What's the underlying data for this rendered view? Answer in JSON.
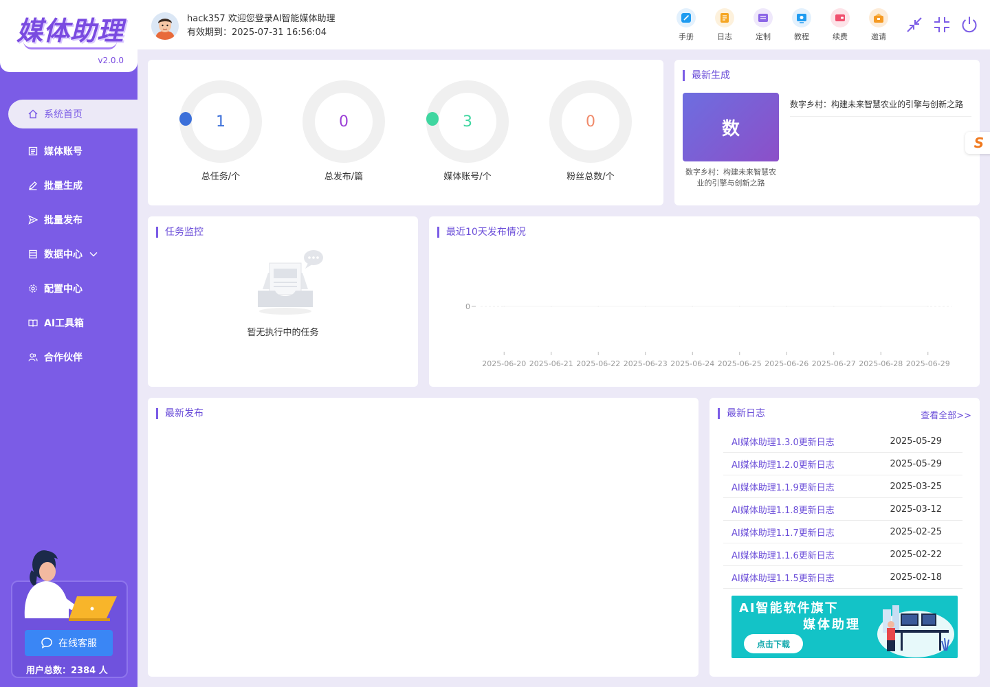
{
  "app": {
    "logo_text": "媒体助理",
    "version": "v2.0.0"
  },
  "sidebar": {
    "items": [
      {
        "label": "系统首页",
        "icon": "home-icon"
      },
      {
        "label": "媒体账号",
        "icon": "account-icon"
      },
      {
        "label": "批量生成",
        "icon": "edit-icon"
      },
      {
        "label": "批量发布",
        "icon": "send-icon"
      },
      {
        "label": "数据中心",
        "icon": "data-icon"
      },
      {
        "label": "配置中心",
        "icon": "gear-icon"
      },
      {
        "label": "AI工具箱",
        "icon": "book-icon"
      },
      {
        "label": "合作伙伴",
        "icon": "partner-icon"
      }
    ],
    "support_label": "在线客服",
    "user_count_label": "用户总数：2384 人"
  },
  "header": {
    "greeting": "hack357 欢迎您登录AI智能媒体助理",
    "expiry": "有效期到：2025-07-31 16:56:04",
    "tools": [
      {
        "label": "手册",
        "icon": "manual-icon",
        "color": "#1e9bf0"
      },
      {
        "label": "日志",
        "icon": "log-icon",
        "color": "#f5a623"
      },
      {
        "label": "定制",
        "icon": "custom-icon",
        "color": "#8c67e6"
      },
      {
        "label": "教程",
        "icon": "tutorial-icon",
        "color": "#1e9bf0"
      },
      {
        "label": "续费",
        "icon": "renew-icon",
        "color": "#f0506e"
      },
      {
        "label": "邀请",
        "icon": "invite-icon",
        "color": "#f59a23"
      }
    ]
  },
  "stats": [
    {
      "value": "1",
      "label": "总任务/个",
      "color": "#3b6fd9"
    },
    {
      "value": "0",
      "label": "总发布/篇",
      "color": "#9b3fd6"
    },
    {
      "value": "3",
      "label": "媒体账号/个",
      "color": "#3fd6a0"
    },
    {
      "value": "0",
      "label": "粉丝总数/个",
      "color": "#f08a6a"
    }
  ],
  "latest_generated": {
    "title": "最新生成",
    "thumb_text": "数",
    "caption": "数字乡村：构建未来智慧农业的引擎与创新之路",
    "item_title": "数字乡村：构建未来智慧农业的引擎与创新之路"
  },
  "task_monitor": {
    "title": "任务监控",
    "empty_text": "暂无执行中的任务"
  },
  "publish_chart": {
    "title": "最近10天发布情况"
  },
  "chart_data": {
    "type": "line",
    "categories": [
      "2025-06-20",
      "2025-06-21",
      "2025-06-22",
      "2025-06-23",
      "2025-06-24",
      "2025-06-25",
      "2025-06-26",
      "2025-06-27",
      "2025-06-28",
      "2025-06-29"
    ],
    "values": [
      0,
      0,
      0,
      0,
      0,
      0,
      0,
      0,
      0,
      0
    ],
    "yticks": [
      "0"
    ],
    "ylim": [
      0,
      1
    ],
    "grid": true
  },
  "latest_publish": {
    "title": "最新发布"
  },
  "latest_logs": {
    "title": "最新日志",
    "view_all": "查看全部>>",
    "items": [
      {
        "name": "AI媒体助理1.3.0更新日志",
        "date": "2025-05-29"
      },
      {
        "name": "AI媒体助理1.2.0更新日志",
        "date": "2025-05-29"
      },
      {
        "name": "AI媒体助理1.1.9更新日志",
        "date": "2025-03-25"
      },
      {
        "name": "AI媒体助理1.1.8更新日志",
        "date": "2025-03-12"
      },
      {
        "name": "AI媒体助理1.1.7更新日志",
        "date": "2025-02-25"
      },
      {
        "name": "AI媒体助理1.1.6更新日志",
        "date": "2025-02-22"
      },
      {
        "name": "AI媒体助理1.1.5更新日志",
        "date": "2025-02-18"
      }
    ],
    "banner_line1": "AI智能软件旗下",
    "banner_line2": "媒体助理",
    "banner_button": "点击下载"
  },
  "colors": {
    "sidebar": "#7b5ce6",
    "accent": "#6c4fd9",
    "background": "#ece9f7",
    "banner": "#13c3c7"
  }
}
